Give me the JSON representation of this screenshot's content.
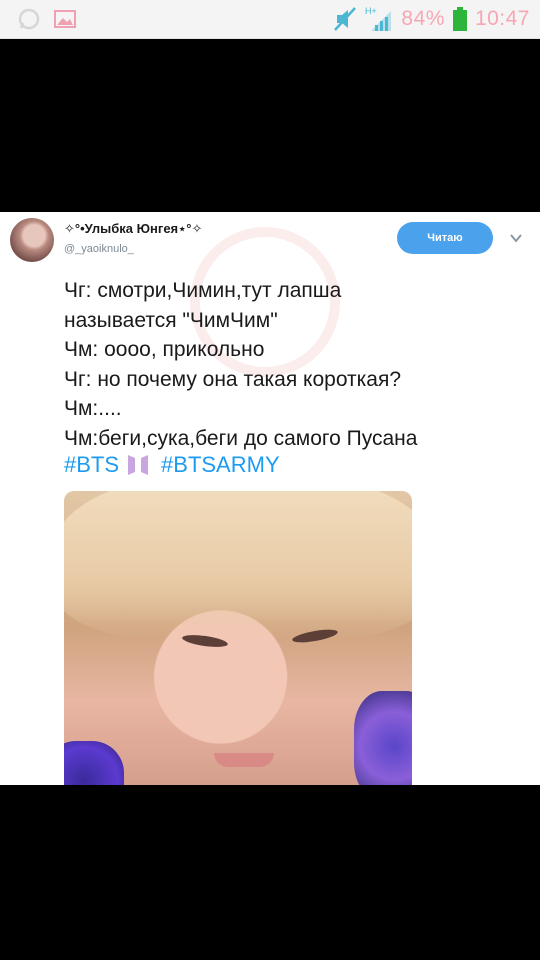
{
  "status_bar": {
    "battery": "84%",
    "time": "10:47",
    "network": "H+",
    "icons": [
      "whatsapp-icon",
      "gallery-icon",
      "mute-icon",
      "signal-icon",
      "battery-icon"
    ]
  },
  "tweet": {
    "display_name": "✧°•Улыбка Юнгея⋆°✧",
    "handle": "@_yaoiknulo_",
    "follow_label": "Читаю",
    "lines": [
      "Чг: смотри,Чимин,тут лапша",
      "называется \"ЧимЧим\"",
      "Чм: оооо, прикольно",
      "Чг: но почему она такая короткая?",
      "Чм:....",
      "Чм:беги,сука,беги до самого Пусана"
    ],
    "hashtags": [
      "#BTS",
      "#BTSARMY"
    ]
  },
  "colors": {
    "accent": "#1d9bf0",
    "button": "#4aa1ec",
    "status_text": "#f7a6b4"
  }
}
